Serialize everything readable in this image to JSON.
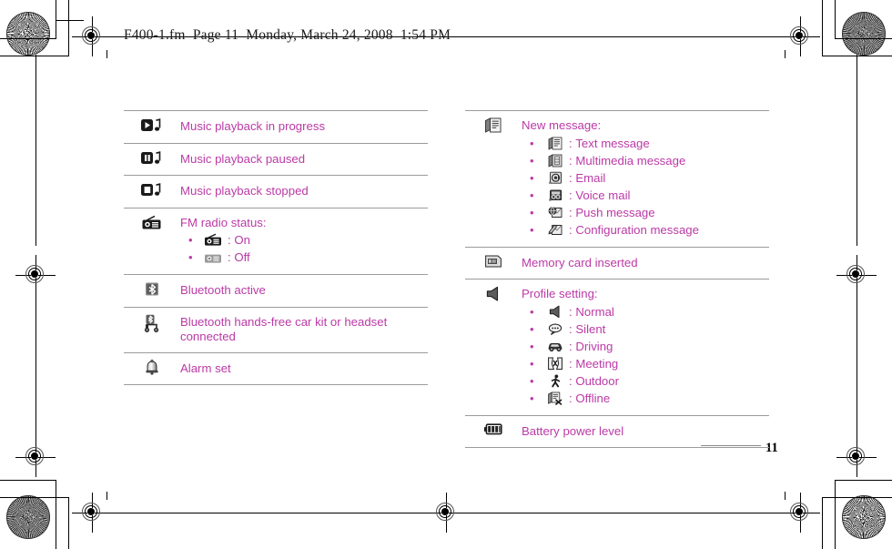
{
  "header": {
    "text": "F400-1.fm  Page 11  Monday, March 24, 2008  1:54 PM"
  },
  "page_number": "11",
  "colors": {
    "text_magenta": "#bb3aa6",
    "rule_grey": "#9b9b9b",
    "ink_black": "#000000"
  },
  "left_table": {
    "rows": [
      {
        "icon": "music-play-note-icon",
        "label": "Music playback in progress",
        "sub": []
      },
      {
        "icon": "music-pause-note-icon",
        "label": "Music playback paused",
        "sub": []
      },
      {
        "icon": "music-stop-note-icon",
        "label": "Music playback stopped",
        "sub": []
      },
      {
        "icon": "fm-radio-icon",
        "label": "FM radio status:",
        "sub": [
          {
            "bullet": "•",
            "icon": "fm-radio-on-icon",
            "separator": ":",
            "label": "On"
          },
          {
            "bullet": "•",
            "icon": "fm-radio-off-icon",
            "separator": ":",
            "label": "Off"
          }
        ]
      },
      {
        "icon": "bluetooth-active-icon",
        "label": "Bluetooth active",
        "sub": []
      },
      {
        "icon": "bluetooth-headset-icon",
        "label": "Bluetooth hands-free car kit or headset connected",
        "sub": []
      },
      {
        "icon": "alarm-bell-icon",
        "label": "Alarm set",
        "sub": []
      }
    ]
  },
  "right_table": {
    "rows": [
      {
        "icon": "new-message-icon",
        "label": "New message:",
        "sub": [
          {
            "bullet": "•",
            "icon": "text-message-icon",
            "separator": ":",
            "label": "Text message"
          },
          {
            "bullet": "•",
            "icon": "multimedia-message-icon",
            "separator": ":",
            "label": "Multimedia message"
          },
          {
            "bullet": "•",
            "icon": "email-icon",
            "separator": ":",
            "label": "Email"
          },
          {
            "bullet": "•",
            "icon": "voice-mail-icon",
            "separator": ":",
            "label": "Voice mail"
          },
          {
            "bullet": "•",
            "icon": "push-message-icon",
            "separator": ":",
            "label": "Push message"
          },
          {
            "bullet": "•",
            "icon": "configuration-message-icon",
            "separator": ":",
            "label": "Configuration message"
          }
        ]
      },
      {
        "icon": "memory-card-icon",
        "label": "Memory card inserted",
        "sub": []
      },
      {
        "icon": "profile-speaker-icon",
        "label": "Profile setting:",
        "sub": [
          {
            "bullet": "•",
            "icon": "profile-normal-icon",
            "separator": ":",
            "label": "Normal"
          },
          {
            "bullet": "•",
            "icon": "profile-silent-icon",
            "separator": ":",
            "label": "Silent"
          },
          {
            "bullet": "•",
            "icon": "profile-driving-icon",
            "separator": ":",
            "label": "Driving"
          },
          {
            "bullet": "•",
            "icon": "profile-meeting-icon",
            "separator": ":",
            "label": "Meeting"
          },
          {
            "bullet": "•",
            "icon": "profile-outdoor-icon",
            "separator": ":",
            "label": "Outdoor"
          },
          {
            "bullet": "•",
            "icon": "profile-offline-icon",
            "separator": ":",
            "label": "Offline"
          }
        ]
      },
      {
        "icon": "battery-icon",
        "label": "Battery power level",
        "sub": []
      }
    ]
  }
}
